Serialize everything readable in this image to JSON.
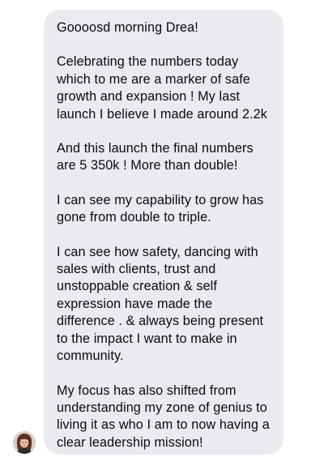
{
  "message": {
    "paragraphs": [
      "Goooosd morning Drea!",
      "Celebrating the numbers today which to me are a marker of safe growth and expansion ! My last launch I believe I made around 2.2k",
      "And this launch the final numbers are 5 350k ! More than double!",
      "I can see my capability to grow has gone from double to triple.",
      "I can see how safety, dancing with sales with clients, trust and unstoppable creation & self expression have made the difference . & always being present to the impact I want to make in community.",
      "My focus has also shifted from understanding my zone of genius to living it as who I am to now having a clear leadership mission!"
    ]
  },
  "sender": {
    "avatar_icon": "profile-avatar"
  },
  "colors": {
    "bubble_background": "#eaebef",
    "text": "#0b0b0d",
    "page_background": "#ffffff"
  }
}
